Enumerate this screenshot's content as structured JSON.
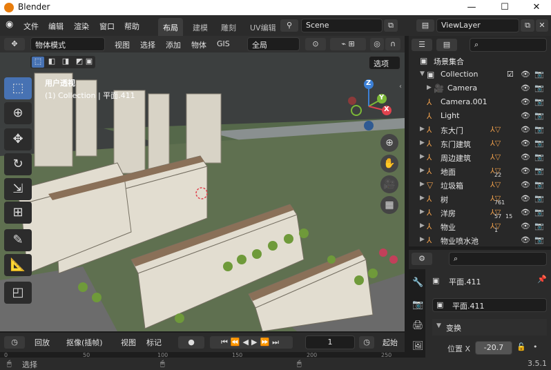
{
  "titlebar": {
    "title": "Blender",
    "minimize": "—",
    "maximize": "☐",
    "close": "✕"
  },
  "menu": [
    "文件",
    "编辑",
    "渲染",
    "窗口",
    "帮助"
  ],
  "workspaces": [
    "布局",
    "建模",
    "雕刻",
    "UV编辑"
  ],
  "scene": {
    "label": "Scene",
    "viewlayer": "ViewLayer"
  },
  "vpheader": {
    "mode": "物体模式",
    "menus": [
      "视图",
      "选择",
      "添加",
      "物体",
      "GIS"
    ],
    "transform": "全局",
    "options": "选项"
  },
  "overlay": {
    "view_name": "用户透视",
    "collection_info": "(1) Collection | 平面.411"
  },
  "gizmo": {
    "z": "Z",
    "y": "Y",
    "x": "X"
  },
  "outliner": {
    "search_placeholder": "",
    "rows": [
      {
        "label": "场景集合",
        "icon": "scene-collection-icon"
      },
      {
        "label": "Collection",
        "icon": "collection-icon"
      },
      {
        "label": "Camera",
        "icon": "camera-icon"
      },
      {
        "label": "Camera.001",
        "icon": "object-icon"
      },
      {
        "label": "Light",
        "icon": "object-icon"
      },
      {
        "label": "东大门",
        "icon": "object-icon"
      },
      {
        "label": "东门建筑",
        "icon": "object-icon"
      },
      {
        "label": "周边建筑",
        "icon": "object-icon"
      },
      {
        "label": "地面",
        "icon": "object-icon",
        "count": "22"
      },
      {
        "label": "垃圾箱",
        "icon": "mesh-icon"
      },
      {
        "label": "树",
        "icon": "object-icon",
        "count": "761"
      },
      {
        "label": "洋房",
        "icon": "object-icon",
        "count": "57",
        "count2": "15"
      },
      {
        "label": "物业",
        "icon": "object-icon",
        "count": "1"
      },
      {
        "label": "物业喷水池",
        "icon": "object-icon"
      }
    ]
  },
  "props": {
    "object_name": "平面.411",
    "data_name": "平面.411",
    "section": "变换",
    "loc_label": "位置 X",
    "loc_value": "-20.7"
  },
  "timeline": {
    "playback": "回放",
    "keying": "抠像(插帧)",
    "view": "视图",
    "marker": "标记",
    "frame": "1",
    "start": "起始"
  },
  "ruler": [
    "0",
    "50",
    "100",
    "150",
    "200",
    "250"
  ],
  "status": {
    "select": "选择",
    "version": "3.5.1"
  },
  "colors": {
    "accent": "#4772b3",
    "axis_x": "#e0434e",
    "axis_y": "#7cb937",
    "axis_z": "#3c80d6",
    "object": "#e69a4a"
  }
}
